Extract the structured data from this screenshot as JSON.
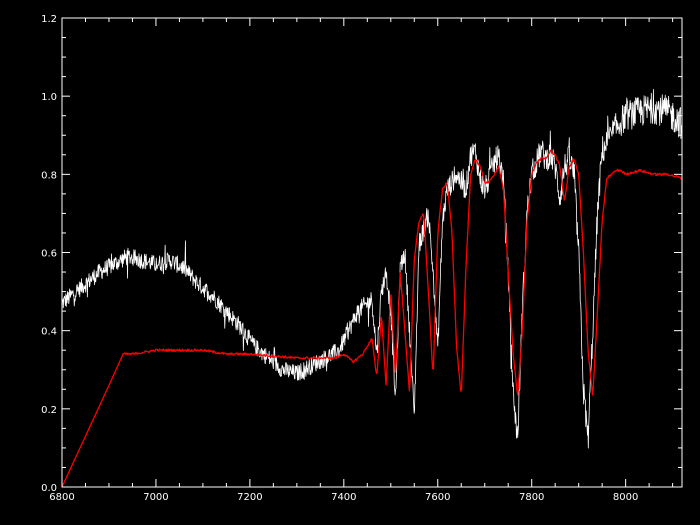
{
  "chart_data": {
    "type": "line",
    "title": "",
    "xlabel": "",
    "ylabel": "",
    "xlim": [
      6800,
      8120
    ],
    "ylim": [
      0.0,
      1.2
    ],
    "x_ticks": [
      6800,
      7000,
      7200,
      7400,
      7600,
      7800,
      8000
    ],
    "x_tick_labels": [
      "6800",
      "7000",
      "7200",
      "7400",
      "7600",
      "7800",
      "8000"
    ],
    "y_ticks": [
      0.0,
      0.2,
      0.4,
      0.6,
      0.8,
      1.0,
      1.2
    ],
    "y_tick_labels": [
      "0.0",
      "0.2",
      "0.4",
      "0.6",
      "0.8",
      "1.0",
      "1.2"
    ],
    "grid": false,
    "background": "#000000",
    "axis_color": "#ffffff",
    "series": [
      {
        "color": "#ffffff",
        "noisy": true,
        "x": [
          6800,
          6820,
          6850,
          6880,
          6910,
          6940,
          6970,
          7000,
          7030,
          7060,
          7090,
          7120,
          7150,
          7180,
          7210,
          7240,
          7270,
          7300,
          7330,
          7360,
          7390,
          7410,
          7430,
          7450,
          7460,
          7470,
          7480,
          7490,
          7500,
          7510,
          7520,
          7530,
          7540,
          7550,
          7560,
          7570,
          7580,
          7590,
          7600,
          7610,
          7620,
          7630,
          7640,
          7650,
          7660,
          7670,
          7680,
          7690,
          7700,
          7710,
          7720,
          7730,
          7740,
          7750,
          7760,
          7770,
          7780,
          7790,
          7800,
          7810,
          7820,
          7830,
          7840,
          7850,
          7860,
          7870,
          7880,
          7890,
          7900,
          7910,
          7920,
          7930,
          7940,
          7950,
          7960,
          7970,
          7980,
          8000,
          8030,
          8060,
          8090,
          8120
        ],
        "y": [
          0.47,
          0.49,
          0.52,
          0.55,
          0.57,
          0.59,
          0.58,
          0.57,
          0.58,
          0.56,
          0.52,
          0.49,
          0.45,
          0.41,
          0.36,
          0.33,
          0.3,
          0.29,
          0.31,
          0.33,
          0.35,
          0.4,
          0.45,
          0.47,
          0.48,
          0.34,
          0.5,
          0.55,
          0.45,
          0.22,
          0.56,
          0.6,
          0.4,
          0.18,
          0.62,
          0.66,
          0.7,
          0.55,
          0.35,
          0.68,
          0.76,
          0.78,
          0.8,
          0.78,
          0.76,
          0.85,
          0.86,
          0.79,
          0.76,
          0.79,
          0.83,
          0.85,
          0.78,
          0.55,
          0.25,
          0.12,
          0.45,
          0.7,
          0.8,
          0.83,
          0.86,
          0.84,
          0.85,
          0.82,
          0.74,
          0.82,
          0.84,
          0.8,
          0.6,
          0.25,
          0.12,
          0.4,
          0.7,
          0.86,
          0.88,
          0.9,
          0.92,
          0.95,
          0.96,
          0.97,
          0.96,
          0.93
        ]
      },
      {
        "color": "#ff0000",
        "noisy": false,
        "x": [
          6800,
          6850,
          6900,
          6930,
          6950,
          7000,
          7050,
          7100,
          7150,
          7200,
          7250,
          7300,
          7350,
          7380,
          7400,
          7420,
          7440,
          7460,
          7470,
          7480,
          7490,
          7500,
          7510,
          7520,
          7530,
          7540,
          7550,
          7560,
          7570,
          7580,
          7590,
          7600,
          7610,
          7620,
          7630,
          7640,
          7650,
          7660,
          7670,
          7680,
          7690,
          7700,
          7710,
          7720,
          7730,
          7740,
          7750,
          7760,
          7770,
          7780,
          7790,
          7800,
          7810,
          7820,
          7830,
          7840,
          7850,
          7860,
          7870,
          7880,
          7890,
          7900,
          7910,
          7920,
          7930,
          7940,
          7950,
          7960,
          7970,
          7980,
          7990,
          8000,
          8030,
          8060,
          8090,
          8120
        ],
        "y": [
          0.0,
          0.13,
          0.26,
          0.34,
          0.34,
          0.35,
          0.35,
          0.35,
          0.34,
          0.34,
          0.335,
          0.33,
          0.33,
          0.33,
          0.34,
          0.32,
          0.34,
          0.38,
          0.28,
          0.44,
          0.26,
          0.5,
          0.28,
          0.55,
          0.4,
          0.24,
          0.58,
          0.68,
          0.7,
          0.5,
          0.28,
          0.65,
          0.76,
          0.78,
          0.66,
          0.36,
          0.23,
          0.56,
          0.8,
          0.84,
          0.82,
          0.78,
          0.78,
          0.8,
          0.82,
          0.76,
          0.55,
          0.35,
          0.23,
          0.4,
          0.68,
          0.8,
          0.83,
          0.84,
          0.84,
          0.86,
          0.85,
          0.82,
          0.73,
          0.82,
          0.84,
          0.8,
          0.6,
          0.35,
          0.23,
          0.45,
          0.68,
          0.79,
          0.8,
          0.81,
          0.81,
          0.8,
          0.81,
          0.8,
          0.8,
          0.79
        ]
      }
    ]
  }
}
